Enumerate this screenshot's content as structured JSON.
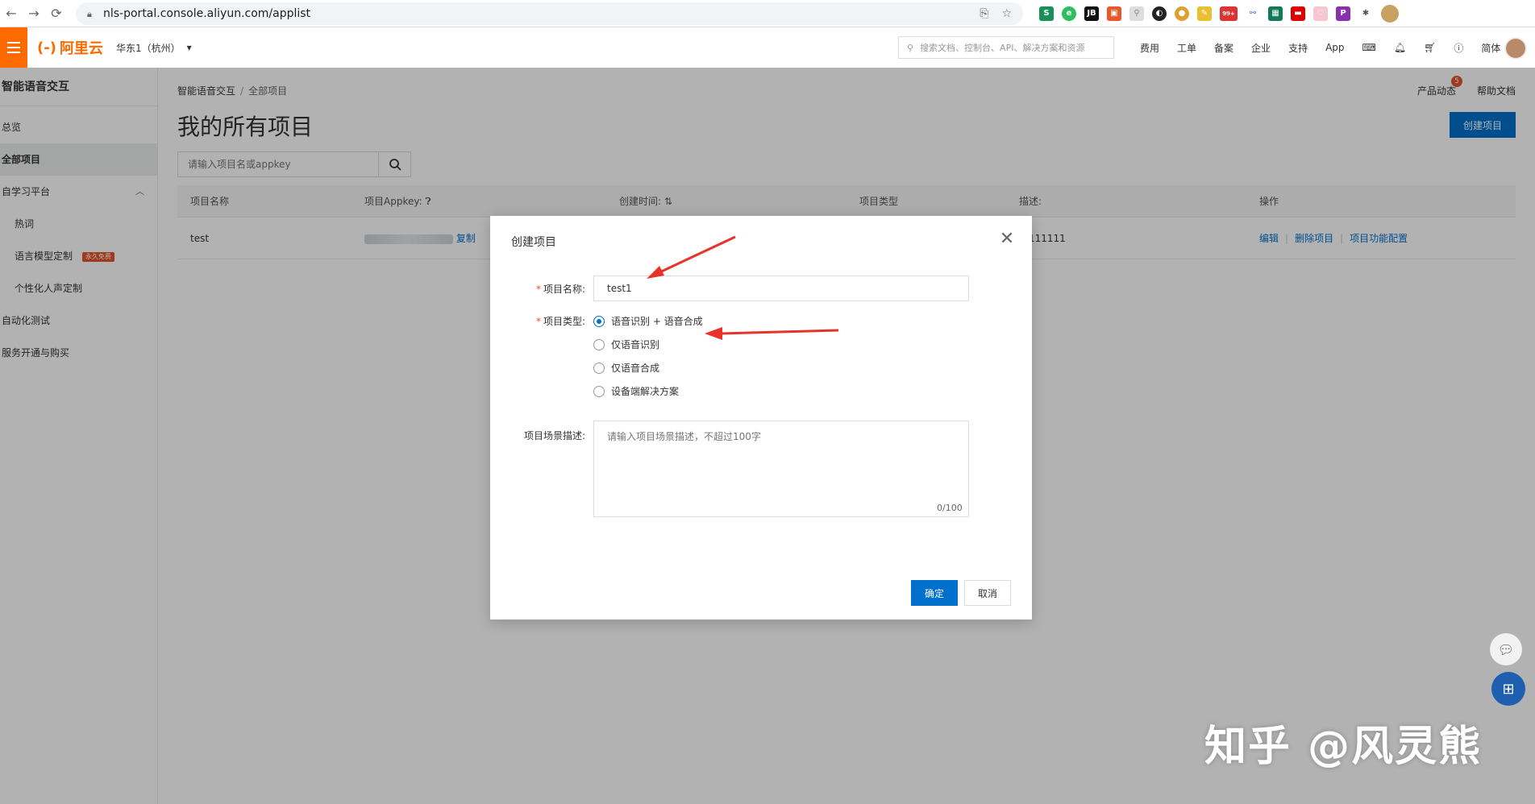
{
  "browser": {
    "url": "nls-portal.console.aliyun.com/applist",
    "ext_badge": "99+"
  },
  "header": {
    "logo_text": "阿里云",
    "logo_mark": "(-)",
    "region": "华东1（杭州）",
    "search_placeholder": "搜索文档、控制台、API、解决方案和资源",
    "nav": [
      "费用",
      "工单",
      "备案",
      "企业",
      "支持",
      "App"
    ],
    "lang": "简体",
    "accent_color": "#ff6a00"
  },
  "sidebar": {
    "title": "智能语音交互",
    "items": [
      {
        "label": "总览"
      },
      {
        "label": "全部项目"
      },
      {
        "label": "自学习平台"
      },
      {
        "label": "热词"
      },
      {
        "label": "语言模型定制",
        "badge": "永久免费"
      },
      {
        "label": "个性化人声定制"
      },
      {
        "label": "自动化测试"
      },
      {
        "label": "服务开通与购买"
      }
    ]
  },
  "main": {
    "breadcrumb": [
      "智能语音交互",
      "全部项目"
    ],
    "top_links": {
      "news": "产品动态",
      "news_count": "5",
      "help": "帮助文档"
    },
    "title": "我的所有项目",
    "create_button": "创建项目",
    "search_placeholder": "请输入项目名或appkey",
    "table": {
      "headers": [
        "项目名称",
        "项目Appkey",
        "创建时间",
        "项目类型",
        "描述",
        "操作"
      ],
      "rows": [
        {
          "name": "test",
          "appkey_tail": "复制",
          "desc": "试111111",
          "actions": [
            "编辑",
            "删除项目",
            "项目功能配置"
          ]
        }
      ]
    }
  },
  "modal": {
    "title": "创建项目",
    "name_label": "项目名称:",
    "name_value": "test1",
    "type_label": "项目类型:",
    "type_options": [
      "语音识别 + 语音合成",
      "仅语音识别",
      "仅语音合成",
      "设备端解决方案"
    ],
    "selected_type": 0,
    "desc_label": "项目场景描述:",
    "desc_placeholder": "请输入项目场景描述，不超过100字",
    "desc_counter": "0/100",
    "ok_button": "确定",
    "cancel_button": "取消",
    "primary_color": "#0070cc"
  },
  "watermark": "知乎 @风灵熊"
}
